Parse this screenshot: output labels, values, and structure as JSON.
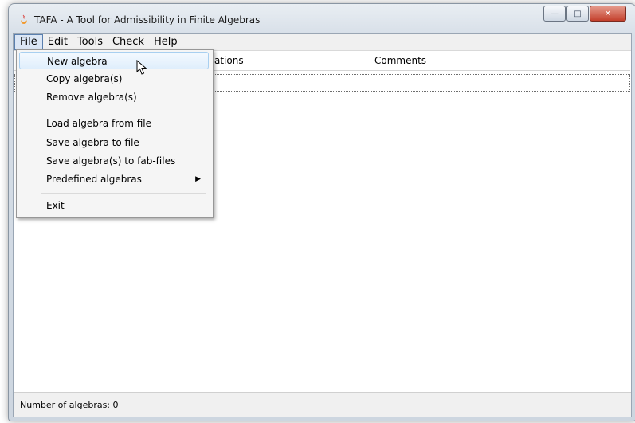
{
  "window": {
    "title": "TAFA - A Tool for Admissibility in Finite Algebras",
    "buttons": {
      "minimize": "—",
      "maximize": "□",
      "close": "✕"
    }
  },
  "menubar": {
    "items": [
      "File",
      "Edit",
      "Tools",
      "Check",
      "Help"
    ]
  },
  "table": {
    "columns": [
      "ations",
      "Comments"
    ]
  },
  "file_menu": {
    "items": [
      "New algebra",
      "Copy algebra(s)",
      "Remove algebra(s)",
      "Load algebra from file",
      "Save algebra to file",
      "Save algebra(s) to fab-files",
      "Predefined algebras",
      "Exit"
    ],
    "submenu_arrow": "▶"
  },
  "status": {
    "text": "Number of algebras: 0"
  }
}
